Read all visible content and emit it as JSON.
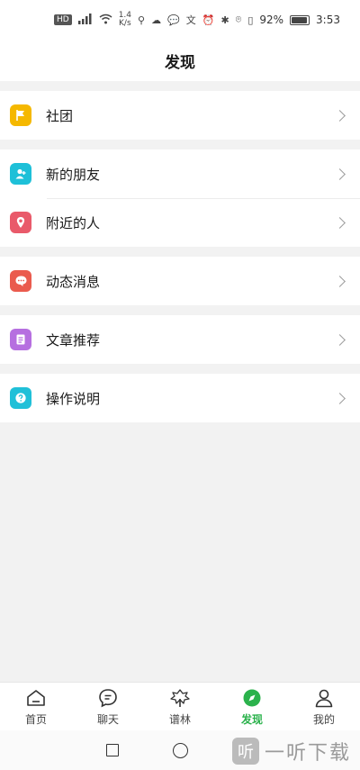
{
  "status_bar": {
    "network_type": "HD",
    "speed": "1.4\nK/s",
    "battery": "92%",
    "time": "3:53"
  },
  "header": {
    "title": "发现"
  },
  "menu": {
    "group1": [
      {
        "label": "社团",
        "icon": "flag-icon",
        "color": "#f5b800"
      }
    ],
    "group2": [
      {
        "label": "新的朋友",
        "icon": "add-friend-icon",
        "color": "#1ec0d8"
      },
      {
        "label": "附近的人",
        "icon": "location-pin-icon",
        "color": "#e95a6a"
      }
    ],
    "group3": [
      {
        "label": "动态消息",
        "icon": "chat-bubble-icon",
        "color": "#ea5b4e"
      }
    ],
    "group4": [
      {
        "label": "文章推荐",
        "icon": "article-icon",
        "color": "#b66fe0"
      }
    ],
    "group5": [
      {
        "label": "操作说明",
        "icon": "help-icon",
        "color": "#20c0d8"
      }
    ]
  },
  "tabbar": {
    "tabs": [
      {
        "label": "首页",
        "icon": "home-icon"
      },
      {
        "label": "聊天",
        "icon": "chat-icon"
      },
      {
        "label": "谱林",
        "icon": "tree-icon"
      },
      {
        "label": "发现",
        "icon": "compass-icon",
        "active": true
      },
      {
        "label": "我的",
        "icon": "profile-icon"
      }
    ],
    "active_color": "#2bb24c"
  },
  "watermark": {
    "text": "一听下载"
  }
}
